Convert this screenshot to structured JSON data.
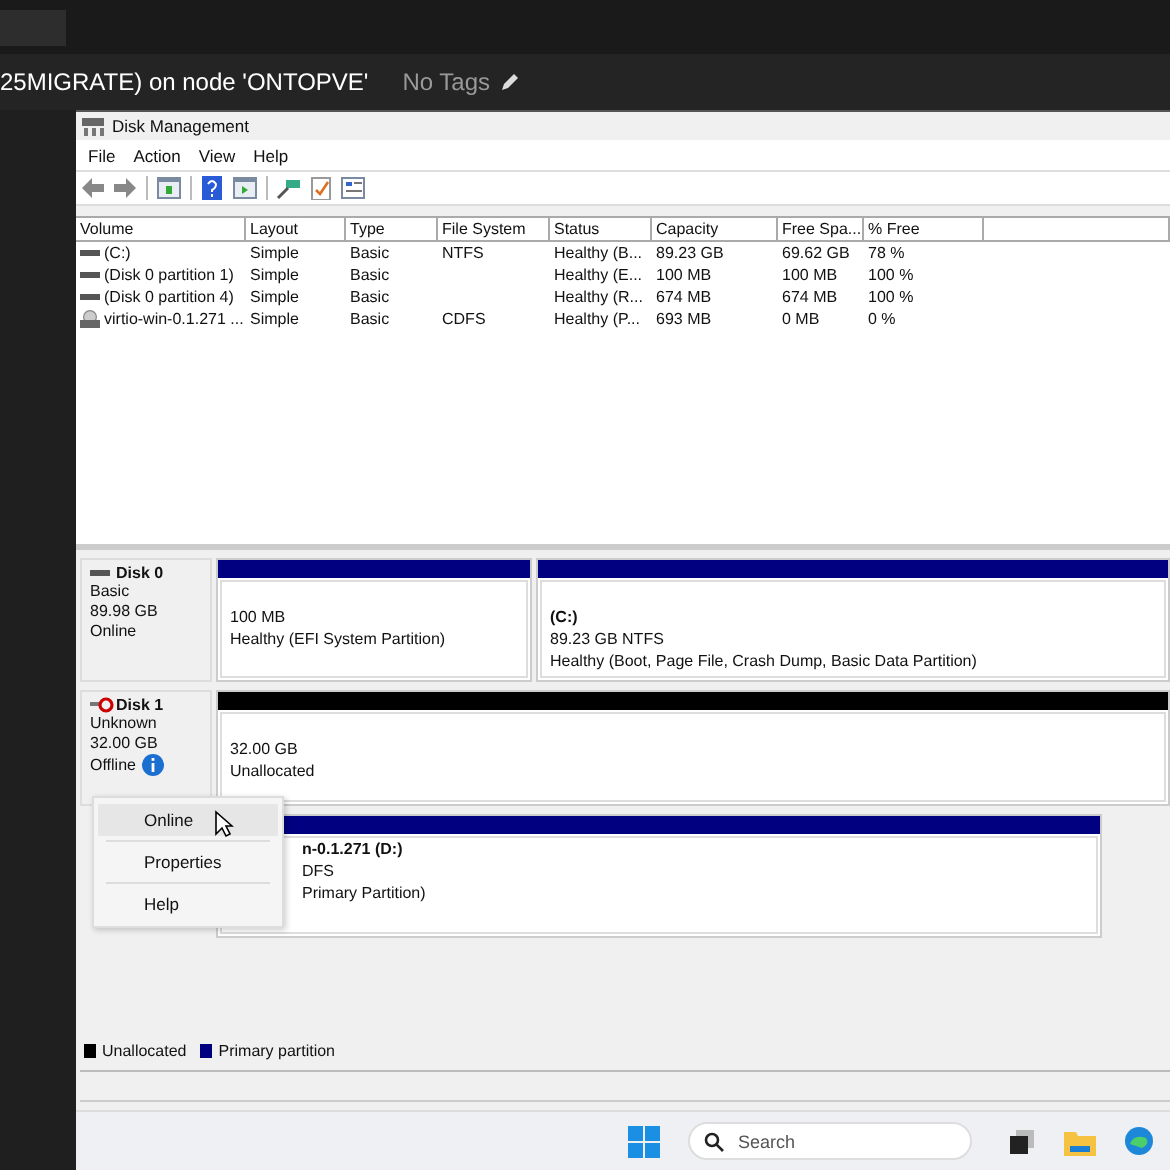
{
  "header": {
    "title": "25MIGRATE) on node 'ONTOPVE'",
    "tags": "No Tags"
  },
  "window": {
    "title": "Disk Management"
  },
  "menu": [
    "File",
    "Action",
    "View",
    "Help"
  ],
  "table": {
    "columns": [
      "Volume",
      "Layout",
      "Type",
      "File System",
      "Status",
      "Capacity",
      "Free Spa...",
      "% Free"
    ],
    "rows": [
      {
        "kind": "disk",
        "cells": [
          "(C:)",
          "Simple",
          "Basic",
          "NTFS",
          "Healthy (B...",
          "89.23 GB",
          "69.62 GB",
          "78 %"
        ]
      },
      {
        "kind": "disk",
        "cells": [
          "(Disk 0 partition 1)",
          "Simple",
          "Basic",
          "",
          "Healthy (E...",
          "100 MB",
          "100 MB",
          "100 %"
        ]
      },
      {
        "kind": "disk",
        "cells": [
          "(Disk 0 partition 4)",
          "Simple",
          "Basic",
          "",
          "Healthy (R...",
          "674 MB",
          "674 MB",
          "100 %"
        ]
      },
      {
        "kind": "cd",
        "cells": [
          "virtio-win-0.1.271 ...",
          "Simple",
          "Basic",
          "CDFS",
          "Healthy (P...",
          "693 MB",
          "0 MB",
          "0 %"
        ]
      }
    ]
  },
  "disks": [
    {
      "kind": "online",
      "name": "Disk 0",
      "details": [
        "Basic",
        "89.98 GB",
        "Online"
      ],
      "partitions": [
        {
          "color": "#000080",
          "lines": [
            "100 MB",
            "Healthy (EFI System Partition)"
          ]
        },
        {
          "color": "#000080",
          "title": "(C:)",
          "lines": [
            "89.23 GB NTFS",
            "Healthy (Boot, Page File, Crash Dump, Basic Data Partition)"
          ]
        }
      ]
    },
    {
      "kind": "offline",
      "name": "Disk 1",
      "details": [
        "Unknown",
        "32.00 GB",
        "Offline"
      ],
      "partitions": [
        {
          "color": "#000000",
          "lines": [
            "32.00 GB",
            "Unallocated"
          ]
        }
      ]
    },
    {
      "kind": "covered",
      "partitions": [
        {
          "color": "#000080",
          "title": "n-0.1.271  (D:)",
          "lines": [
            "DFS",
            "Primary Partition)"
          ]
        }
      ]
    }
  ],
  "context_menu": [
    {
      "label": "Online",
      "selected": true
    },
    {
      "label": "Properties",
      "selected": false
    },
    {
      "label": "Help",
      "selected": false
    }
  ],
  "legend": [
    {
      "label": "Unallocated",
      "color": "#000000"
    },
    {
      "label": "Primary partition",
      "color": "#000080"
    }
  ],
  "taskbar": {
    "search": {
      "placeholder": "Search"
    }
  }
}
